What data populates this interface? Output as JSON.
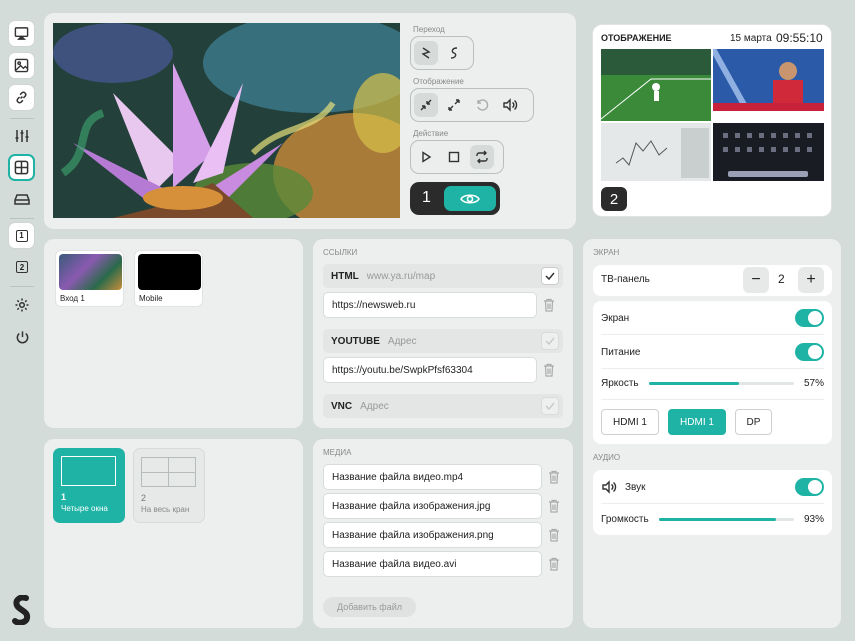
{
  "colors": {
    "accent": "#1fb3a5",
    "dark": "#2b2b2b"
  },
  "sidebar": {
    "icons": [
      "cast-icon",
      "image-icon",
      "link-icon",
      "sliders-icon",
      "grid-icon",
      "drive-icon",
      "screen-1-icon",
      "screen-2-icon",
      "gear-icon",
      "power-icon"
    ],
    "screen_1": "1",
    "screen_2": "2"
  },
  "controls": {
    "transition_label": "Переход",
    "display_label": "Отображение",
    "action_label": "Действие",
    "screen_number": "1"
  },
  "preview": {
    "title": "ОТОБРАЖЕНИЕ",
    "date": "15 марта",
    "time": "09:55:10",
    "screen_number": "2"
  },
  "inputs": {
    "items": [
      {
        "label": "Вход 1"
      },
      {
        "label": "Mobile"
      }
    ]
  },
  "layouts": {
    "items": [
      {
        "number": "1",
        "label": "Четыре окна"
      },
      {
        "number": "2",
        "label": "На весь кран"
      }
    ]
  },
  "links": {
    "title": "ССЫЛКИ",
    "html": {
      "type": "HTML",
      "placeholder": "www.ya.ru/map",
      "value": "https://newsweb.ru"
    },
    "youtube": {
      "type": "YOUTUBE",
      "placeholder": "Адрес",
      "value": "https://youtu.be/SwpkPfsf63304"
    },
    "vnc": {
      "type": "VNC",
      "placeholder": "Адрес"
    }
  },
  "media": {
    "title": "МЕДИА",
    "files": [
      "Название файла видео.mp4",
      "Название файла изображения.jpg",
      "Название файла изображения.png",
      "Название файла видео.avi"
    ],
    "add_label": "Добавить файл"
  },
  "screen": {
    "title": "ЭКРАН",
    "tv_label": "ТВ-панель",
    "tv_count": "2",
    "minus": "−",
    "plus": "+",
    "screen_label": "Экран",
    "power_label": "Питание",
    "brightness_label": "Яркость",
    "brightness_value": "57%",
    "brightness": 0.62,
    "inputs": [
      "HDMI 1",
      "HDMI 1",
      "DP"
    ]
  },
  "audio": {
    "title": "АУДИО",
    "sound_label": "Звук",
    "volume_label": "Громкость",
    "volume_value": "93%",
    "volume": 0.87
  }
}
